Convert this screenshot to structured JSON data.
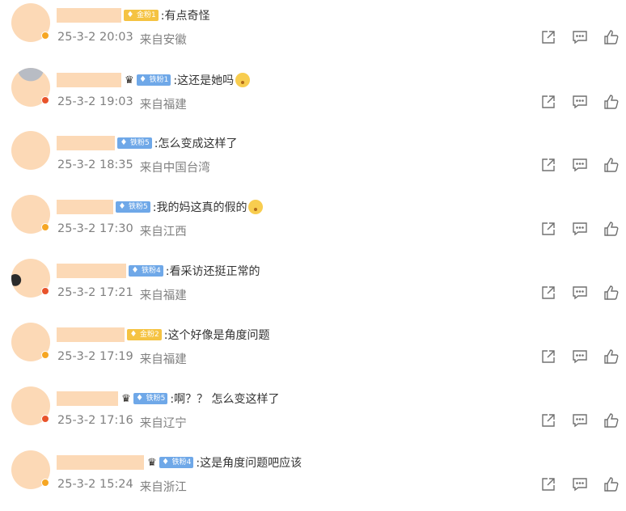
{
  "comments": [
    {
      "text": ":有点奇怪",
      "time": "25-3-2 20:03",
      "location": "来自安徽",
      "badge": {
        "label": "金粉1",
        "style": "gold"
      },
      "crown": false,
      "emoji": false,
      "dot": "orange",
      "avatar_variant": "plain"
    },
    {
      "text": ":这还是她吗",
      "time": "25-3-2 19:03",
      "location": "来自福建",
      "badge": {
        "label": "铁粉1",
        "style": "blue"
      },
      "crown": true,
      "emoji": true,
      "dot": "red",
      "avatar_variant": "grey"
    },
    {
      "text": ":怎么变成这样了",
      "time": "25-3-2 18:35",
      "location": "来自中国台湾",
      "badge": {
        "label": "铁粉5",
        "style": "blue"
      },
      "crown": false,
      "emoji": false,
      "dot": "none",
      "avatar_variant": "plain"
    },
    {
      "text": ":我的妈这真的假的",
      "time": "25-3-2 17:30",
      "location": "来自江西",
      "badge": {
        "label": "铁粉5",
        "style": "blue"
      },
      "crown": false,
      "emoji": true,
      "dot": "orange",
      "avatar_variant": "plain"
    },
    {
      "text": ":看采访还挺正常的",
      "time": "25-3-2 17:21",
      "location": "来自福建",
      "badge": {
        "label": "铁粉4",
        "style": "blue"
      },
      "crown": false,
      "emoji": false,
      "dot": "red",
      "avatar_variant": "dark"
    },
    {
      "text": ":这个好像是角度问题",
      "time": "25-3-2 17:19",
      "location": "来自福建",
      "badge": {
        "label": "金粉2",
        "style": "gold"
      },
      "crown": false,
      "emoji": false,
      "dot": "orange",
      "avatar_variant": "plain"
    },
    {
      "text": ":啊？？ 怎么变这样了",
      "time": "25-3-2 17:16",
      "location": "来自辽宁",
      "badge": {
        "label": "铁粉5",
        "style": "blue"
      },
      "crown": true,
      "emoji": false,
      "dot": "red",
      "avatar_variant": "plain"
    },
    {
      "text": ":这是角度问题吧应该",
      "time": "25-3-2 15:24",
      "location": "来自浙江",
      "badge": {
        "label": "铁粉4",
        "style": "blue"
      },
      "crown": true,
      "emoji": false,
      "dot": "orange",
      "avatar_variant": "plain"
    }
  ],
  "icons": {
    "share": "share-icon",
    "comment": "comment-icon",
    "like": "like-icon"
  },
  "colors": {
    "badge_gold": "#f5c342",
    "badge_blue": "#6fa8e8",
    "meta_text": "#808080",
    "name_mask": "#fcd9b6"
  }
}
